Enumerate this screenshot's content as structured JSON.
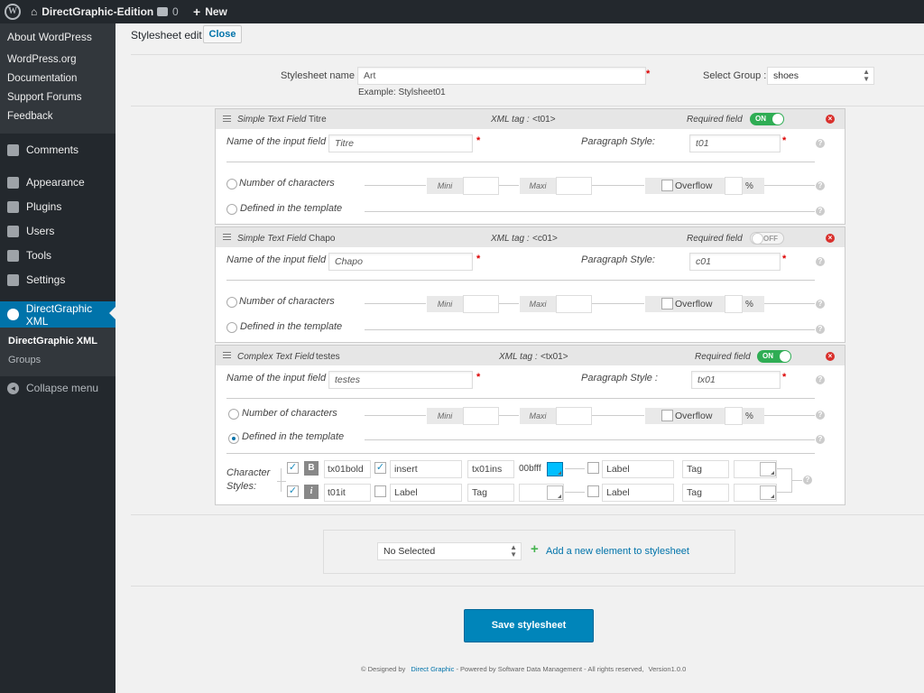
{
  "adminbar": {
    "site_name": "DirectGraphic-Edition",
    "comments_count": "0",
    "new_label": "New"
  },
  "sidebar": {
    "about": "About WordPress",
    "about_links": [
      "WordPress.org",
      "Documentation",
      "Support Forums",
      "Feedback"
    ],
    "items": [
      "Comments",
      "Appearance",
      "Plugins",
      "Users",
      "Tools",
      "Settings",
      "DirectGraphic XML"
    ],
    "submenu": [
      "DirectGraphic XML",
      "Groups"
    ],
    "collapse": "Collapse menu"
  },
  "header": {
    "title": "Stylesheet edit",
    "close_label": "Close"
  },
  "form": {
    "name_label": "Stylesheet name :",
    "name_value": "Art",
    "name_example": "Example: Stylsheet01",
    "group_label": "Select Group :",
    "group_value": "shoes"
  },
  "fields": [
    {
      "type": "Simple Text Field",
      "name": "Titre",
      "xml_label": "XML tag :",
      "xml_tag": "<t01>",
      "required_label": "Required field",
      "required_state": "ON",
      "input_label": "Name of the input field :",
      "input_value": "Titre",
      "pstyle_label": "Paragraph Style:",
      "pstyle_value": "t01",
      "num_chars": "Number of characters",
      "mini": "Mini",
      "maxi": "Maxi",
      "overflow": "Overflow",
      "percent": "%",
      "defined": "Defined in the template"
    },
    {
      "type": "Simple Text Field",
      "name": "Chapo",
      "xml_label": "XML tag :",
      "xml_tag": "<c01>",
      "required_label": "Required field",
      "required_state": "OFF",
      "input_label": "Name of the input field :",
      "input_value": "Chapo",
      "pstyle_label": "Paragraph Style:",
      "pstyle_value": "c01",
      "num_chars": "Number of characters",
      "mini": "Mini",
      "maxi": "Maxi",
      "overflow": "Overflow",
      "percent": "%",
      "defined": "Defined in the template"
    },
    {
      "type": "Complex Text Field",
      "name": "testes",
      "xml_label": "XML tag :",
      "xml_tag": "<tx01>",
      "required_label": "Required field",
      "required_state": "ON",
      "input_label": "Name of the input field :",
      "input_value": "testes",
      "pstyle_label": "Paragraph Style :",
      "pstyle_value": "tx01",
      "num_chars": "Number of characters",
      "mini": "Mini",
      "maxi": "Maxi",
      "overflow": "Overflow",
      "percent": "%",
      "defined": "Defined in the template",
      "char_styles_label": [
        "Character",
        "Styles:"
      ],
      "row1": {
        "b": "B",
        "style": "tx01bold",
        "label1": "insert",
        "tag1": "tx01ins",
        "color1": "00bfff",
        "label2": "Label",
        "tag2": "Tag"
      },
      "row2": {
        "i": "i",
        "style": "t01it",
        "label1": "Label",
        "tag1": "Tag",
        "label2": "Label",
        "tag2": "Tag"
      }
    }
  ],
  "add": {
    "select_value": "No Selected",
    "add_label": "Add a new element to stylesheet"
  },
  "save_label": "Save stylesheet",
  "footer": {
    "designed": "© Designed by",
    "company": "Direct Graphic",
    "rest": "- Powered by Software Data Management - All rights reserved,",
    "version": "Version1.0.0"
  },
  "colors": {
    "accent": "#0073aa",
    "toggle_on": "#2fad54",
    "sidebar": "#23282d",
    "swatch": "#00bfff"
  }
}
